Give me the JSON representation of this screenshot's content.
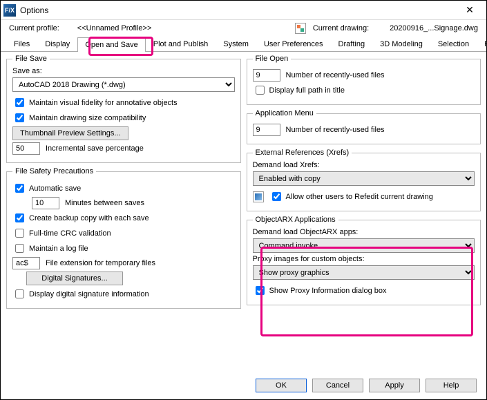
{
  "title": "Options",
  "profile": {
    "label": "Current profile:",
    "value": "<<Unnamed Profile>>"
  },
  "drawing": {
    "label": "Current drawing:",
    "value": "20200916_...Signage.dwg"
  },
  "tabs": [
    "Files",
    "Display",
    "Open and Save",
    "Plot and Publish",
    "System",
    "User Preferences",
    "Drafting",
    "3D Modeling",
    "Selection",
    "Profiles"
  ],
  "active_tab": 2,
  "fileSave": {
    "legend": "File Save",
    "saveAsLabel": "Save as:",
    "saveAsValue": "AutoCAD 2018 Drawing (*.dwg)",
    "maintainVisual": "Maintain visual fidelity for annotative objects",
    "maintainSize": "Maintain drawing size compatibility",
    "thumbBtn": "Thumbnail Preview Settings...",
    "incVal": "50",
    "incLabel": "Incremental save percentage"
  },
  "safety": {
    "legend": "File Safety Precautions",
    "auto": "Automatic save",
    "minVal": "10",
    "minLabel": "Minutes between saves",
    "backup": "Create backup copy with each save",
    "crc": "Full-time CRC validation",
    "log": "Maintain a log file",
    "extVal": "ac$",
    "extLabel": "File extension for temporary files",
    "sigBtn": "Digital Signatures...",
    "sigInfo": "Display digital signature information"
  },
  "fileOpen": {
    "legend": "File Open",
    "recentVal": "9",
    "recentLabel": "Number of recently-used files",
    "fullPath": "Display full path in title"
  },
  "appMenu": {
    "legend": "Application Menu",
    "recentVal": "9",
    "recentLabel": "Number of recently-used files"
  },
  "xref": {
    "legend": "External References (Xrefs)",
    "demandLabel": "Demand load Xrefs:",
    "demandVal": "Enabled with copy",
    "allowRefedit": "Allow other users to Refedit current drawing"
  },
  "arx": {
    "legend": "ObjectARX Applications",
    "demandLabel": "Demand load ObjectARX apps:",
    "demandVal": "Command invoke",
    "proxyLabel": "Proxy images for custom objects:",
    "proxyVal": "Show proxy graphics",
    "showProxy": "Show Proxy Information dialog box"
  },
  "footer": {
    "ok": "OK",
    "cancel": "Cancel",
    "apply": "Apply",
    "help": "Help"
  }
}
